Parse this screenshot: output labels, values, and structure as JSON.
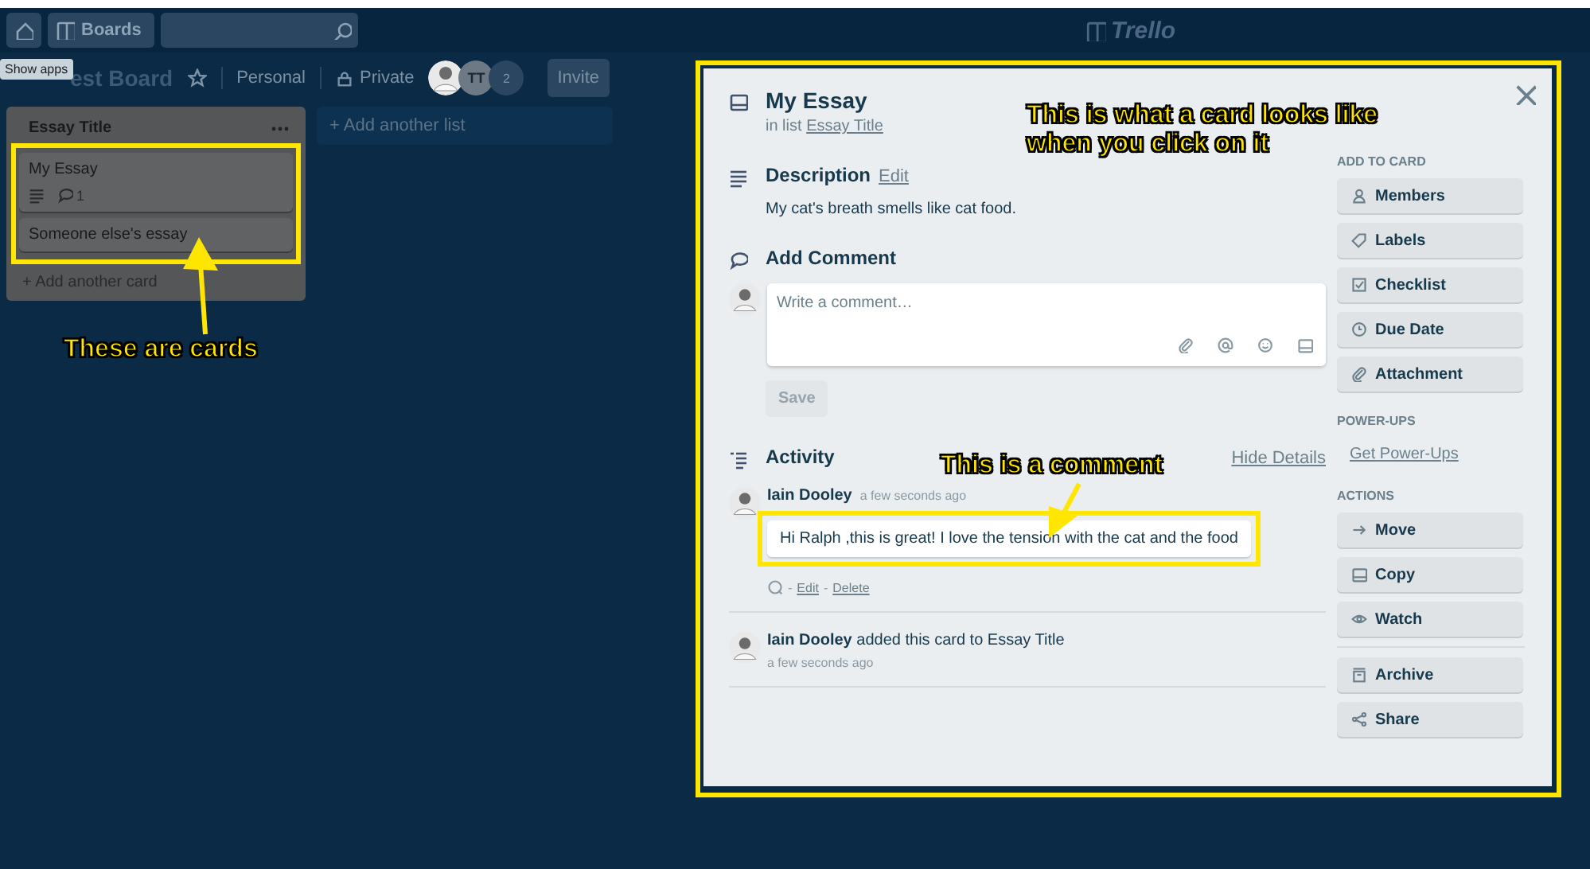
{
  "header": {
    "boards_label": "Boards",
    "logo_text": "Trello"
  },
  "tooltip": {
    "text": "Show apps"
  },
  "board": {
    "title": "est Board",
    "visibility_team": "Personal",
    "visibility": "Private",
    "members": [
      {
        "kind": "photo"
      },
      {
        "kind": "initials",
        "text": "TT"
      },
      {
        "kind": "count",
        "text": "2"
      }
    ],
    "invite": "Invite"
  },
  "lists": [
    {
      "title": "Essay Title",
      "cards": [
        {
          "title": "My Essay",
          "has_description": true,
          "comments": "1"
        },
        {
          "title": "Someone else's essay",
          "has_description": false
        }
      ],
      "add_card": "+ Add another card"
    }
  ],
  "add_list": "+ Add another list",
  "card_detail": {
    "title": "My Essay",
    "list_prefix": "in list",
    "list_name": "Essay Title",
    "description": {
      "heading": "Description",
      "edit": "Edit",
      "text": "My cat's breath smells like cat food."
    },
    "add_comment": {
      "heading": "Add Comment",
      "placeholder": "Write a comment…",
      "save": "Save"
    },
    "activity": {
      "heading": "Activity",
      "toggle": "Hide Details",
      "entries": [
        {
          "kind": "comment",
          "author": "Iain Dooley",
          "time": "a few seconds ago",
          "text": "Hi Ralph ,this is great! I love the tension with the cat and the food",
          "action_separator": "-",
          "actions": [
            "Edit",
            "Delete"
          ]
        },
        {
          "kind": "event",
          "author": "Iain Dooley",
          "text": "added this card to Essay Title",
          "time": "a few seconds ago"
        }
      ]
    },
    "sidebar": [
      {
        "heading": "ADD TO CARD",
        "buttons": [
          "Members",
          "Labels",
          "Checklist",
          "Due Date",
          "Attachment"
        ]
      },
      {
        "heading": "POWER-UPS",
        "link": "Get Power-Ups"
      },
      {
        "heading": "ACTIONS",
        "buttons": [
          "Move",
          "Copy",
          "Watch"
        ],
        "after_divider": [
          "Archive",
          "Share"
        ]
      }
    ]
  },
  "annotations": [
    {
      "text": "This is what a card looks like when you click on it"
    },
    {
      "text": "These are cards"
    },
    {
      "text": "This is a comment"
    }
  ]
}
